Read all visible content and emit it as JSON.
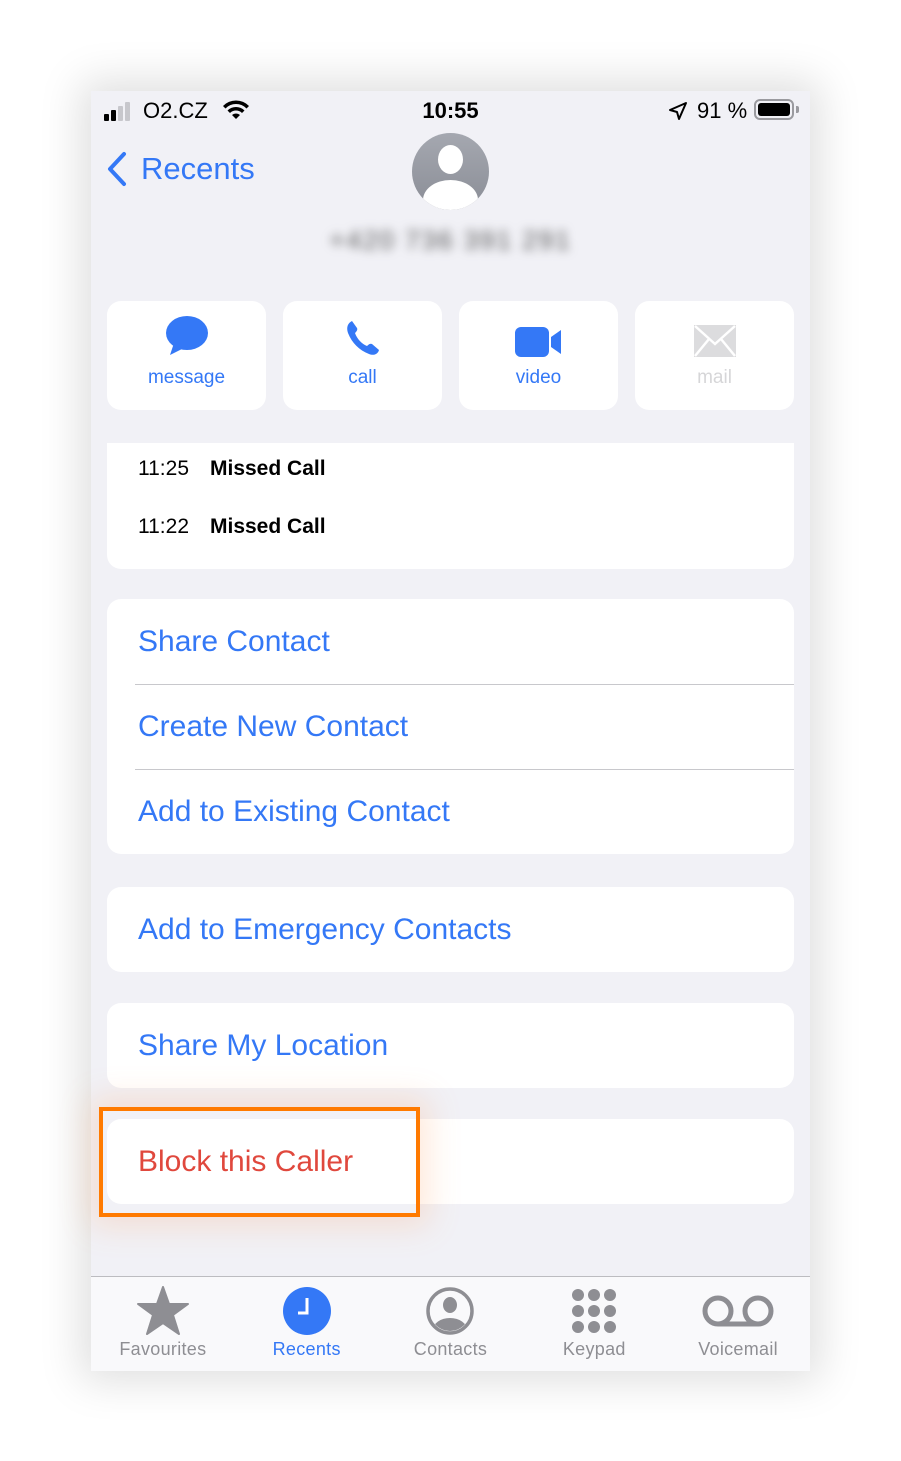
{
  "status_bar": {
    "carrier": "O2.CZ",
    "time": "10:55",
    "battery_percent": "91 %",
    "signal_bars_active": 2,
    "signal_bars_total": 4
  },
  "nav": {
    "back_label": "Recents"
  },
  "contact": {
    "number_blurred": "+420 736 391 291"
  },
  "actions": [
    {
      "label": "message",
      "icon": "message-icon",
      "enabled": true
    },
    {
      "label": "call",
      "icon": "phone-icon",
      "enabled": true
    },
    {
      "label": "video",
      "icon": "video-icon",
      "enabled": true
    },
    {
      "label": "mail",
      "icon": "mail-icon",
      "enabled": false
    }
  ],
  "call_log": [
    {
      "time": "11:25",
      "type": "Missed Call"
    },
    {
      "time": "11:22",
      "type": "Missed Call"
    }
  ],
  "contact_options": [
    {
      "label": "Share Contact"
    },
    {
      "label": "Create New Contact"
    },
    {
      "label": "Add to Existing Contact"
    }
  ],
  "emergency": {
    "label": "Add to Emergency Contacts"
  },
  "location": {
    "label": "Share My Location"
  },
  "block": {
    "label": "Block this Caller"
  },
  "tabs": [
    {
      "label": "Favourites",
      "icon": "star-icon",
      "active": false
    },
    {
      "label": "Recents",
      "icon": "clock-icon",
      "active": true
    },
    {
      "label": "Contacts",
      "icon": "contacts-icon",
      "active": false
    },
    {
      "label": "Keypad",
      "icon": "keypad-icon",
      "active": false
    },
    {
      "label": "Voicemail",
      "icon": "voicemail-icon",
      "active": false
    }
  ],
  "colors": {
    "accent": "#3478f6",
    "danger": "#e0483d",
    "highlight": "#ff7a00",
    "background": "#f1f1f6"
  }
}
